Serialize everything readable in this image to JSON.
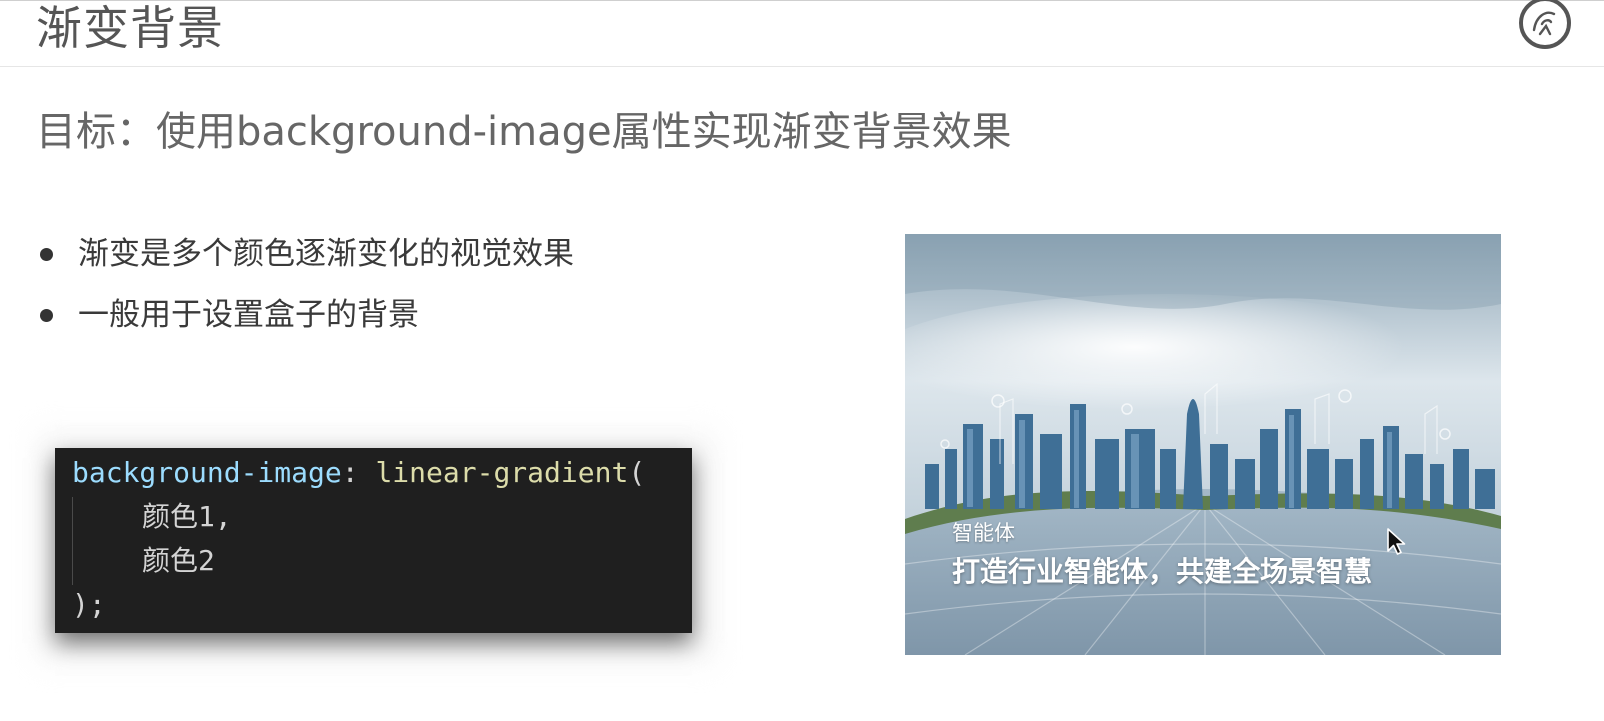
{
  "header": {
    "title": "渐变背景",
    "logo_icon": "brand-logo-icon"
  },
  "goal": "目标：使用background-image属性实现渐变背景效果",
  "bullets": [
    "渐变是多个颜色逐渐变化的视觉效果",
    "一般用于设置盒子的背景"
  ],
  "code": {
    "property": "background-image",
    "colon": ":",
    "function": "linear-gradient",
    "open_paren": "(",
    "arg1": "颜色1,",
    "arg2": "颜色2",
    "close": ");"
  },
  "banner": {
    "kicker": "智能体",
    "headline": "打造行业智能体，共建全场景智慧"
  },
  "colors": {
    "code_bg": "#1f1f1f",
    "code_property": "#9cdcfe",
    "code_function": "#dcdcaa",
    "title_text": "#555555"
  },
  "cursor_icon": "mouse-pointer-icon"
}
